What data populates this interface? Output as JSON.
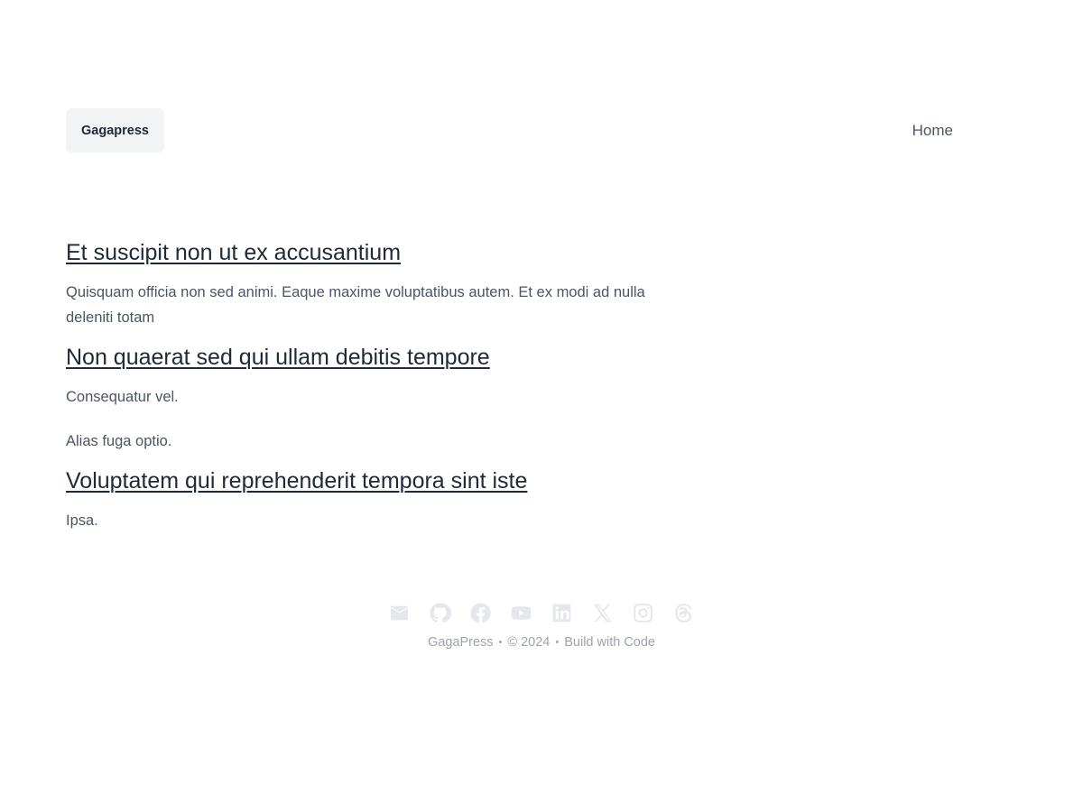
{
  "header": {
    "logo": "Gagapress",
    "nav": [
      {
        "label": "Home"
      }
    ]
  },
  "posts": [
    {
      "title": "Et suscipit non ut ex accusantium",
      "paragraphs": [
        "Quisquam officia non sed animi. Eaque maxime voluptatibus autem. Et ex modi ad nulla deleniti totam"
      ]
    },
    {
      "title": "Non quaerat sed qui ullam debitis tempore",
      "paragraphs": [
        "Consequatur vel.",
        "Alias fuga optio."
      ]
    },
    {
      "title": "Voluptatem qui reprehenderit tempora sint iste",
      "paragraphs": [
        "Ipsa."
      ]
    }
  ],
  "footer": {
    "social_icons": [
      "mail-icon",
      "github-icon",
      "facebook-icon",
      "youtube-icon",
      "linkedin-icon",
      "x-icon",
      "instagram-icon",
      "threads-icon"
    ],
    "site_name": "GagaPress",
    "copyright": "© 2024",
    "tagline": "Build with Code",
    "separator": "•"
  },
  "colors": {
    "text_heading": "#1f2937",
    "text_body": "#4b5563",
    "logo_bg": "#f3f4f6",
    "icon_color": "#e5e7eb",
    "footer_text": "#9ca3af"
  }
}
